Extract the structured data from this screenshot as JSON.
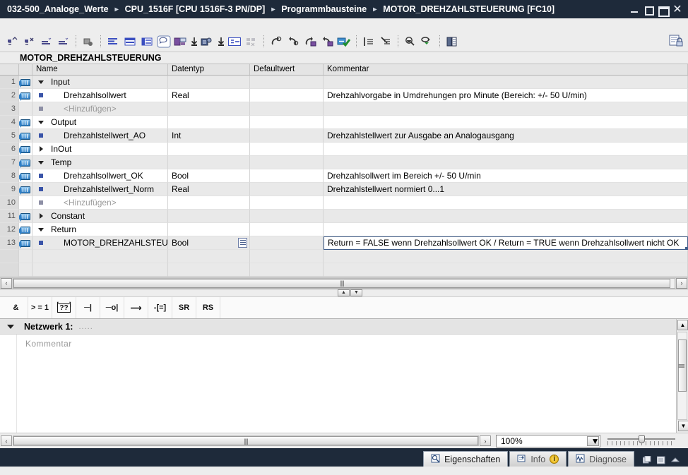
{
  "titlebar": {
    "crumbs": [
      "032-500_Analoge_Werte",
      "CPU_1516F [CPU 1516F-3 PN/DP]",
      "Programmbausteine",
      "MOTOR_DREHZAHLSTEUERUNG [FC10]"
    ],
    "separator": "▸",
    "buttons": {
      "minimize": "minimize",
      "restore": "restore",
      "maximize": "maximize",
      "close": "✕"
    }
  },
  "toolbar": {
    "icons": [
      "insert-network-icon",
      "cut-network-icon",
      "insert-branch-icon",
      "delete-branch-icon",
      "sep",
      "absolute-symbolic-icon",
      "sep",
      "show-absolute-operands-icon",
      "show-symbolic-operands-icon",
      "show-operand-info-icon",
      "comments-icon",
      "insert-network-title-icon",
      "download-to-device-icon",
      "upload-from-device-icon",
      "favorites-icon",
      "disable-layout-icon"
    ],
    "icons2": [
      "monitor-on-icon",
      "monitor-off-icon",
      "modify-value-icon",
      "reset-value-icon",
      "go-online-icon",
      "sep",
      "expand-all-icon",
      "collapse-all-icon",
      "sep",
      "cross-reference-icon",
      "call-structure-icon",
      "sep",
      "compare-blocks-icon"
    ],
    "right_icon": "block-protection-icon"
  },
  "interface": {
    "block_name": "MOTOR_DREHZAHLSTEUERUNG",
    "columns": [
      "",
      "",
      "Name",
      "Datentyp",
      "Defaultwert",
      "Kommentar"
    ],
    "rows": [
      {
        "num": "1",
        "tag": true,
        "marker": "tri-down",
        "indent": 0,
        "name": "Input",
        "type": "",
        "def": "",
        "comment": ""
      },
      {
        "num": "2",
        "tag": true,
        "marker": "sq-blue",
        "indent": 1,
        "name": "Drehzahlsollwert",
        "type": "Real",
        "def": "",
        "comment": "Drehzahlvorgabe in Umdrehungen pro Minute (Bereich: +/- 50 U/min)"
      },
      {
        "num": "3",
        "tag": false,
        "marker": "sq-gray",
        "indent": 1,
        "name": "<Hinzufügen>",
        "type": "",
        "def": "",
        "comment": "",
        "dim": true
      },
      {
        "num": "4",
        "tag": true,
        "marker": "tri-down",
        "indent": 0,
        "name": "Output",
        "type": "",
        "def": "",
        "comment": ""
      },
      {
        "num": "5",
        "tag": true,
        "marker": "sq-blue",
        "indent": 1,
        "name": "Drehzahlstellwert_AO",
        "type": "Int",
        "def": "",
        "comment": "Drehzahlstellwert zur Ausgabe an Analogausgang"
      },
      {
        "num": "6",
        "tag": true,
        "marker": "tri-right",
        "indent": 0,
        "name": "InOut",
        "type": "",
        "def": "",
        "comment": ""
      },
      {
        "num": "7",
        "tag": true,
        "marker": "tri-down",
        "indent": 0,
        "name": "Temp",
        "type": "",
        "def": "",
        "comment": ""
      },
      {
        "num": "8",
        "tag": true,
        "marker": "sq-blue",
        "indent": 1,
        "name": "Drehzahlsollwert_OK",
        "type": "Bool",
        "def": "",
        "comment": "Drehzahlsollwert im Bereich +/- 50 U/min"
      },
      {
        "num": "9",
        "tag": true,
        "marker": "sq-blue",
        "indent": 1,
        "name": "Drehzahlstellwert_Norm",
        "type": "Real",
        "def": "",
        "comment": "Drehzahlstellwert normiert 0...1"
      },
      {
        "num": "10",
        "tag": false,
        "marker": "sq-gray",
        "indent": 1,
        "name": "<Hinzufügen>",
        "type": "",
        "def": "",
        "comment": "",
        "dim": true
      },
      {
        "num": "11",
        "tag": true,
        "marker": "tri-right",
        "indent": 0,
        "name": "Constant",
        "type": "",
        "def": "",
        "comment": ""
      },
      {
        "num": "12",
        "tag": true,
        "marker": "tri-down",
        "indent": 0,
        "name": "Return",
        "type": "",
        "def": "",
        "comment": ""
      },
      {
        "num": "13",
        "tag": true,
        "marker": "sq-blue",
        "indent": 1,
        "name": "MOTOR_DREHZAHLSTEUE",
        "type": "Bool",
        "def": "",
        "comment": "Return = FALSE wenn Drehzahlsollwert OK / Return = TRUE wenn Drehzahlsollwert nicht OK",
        "selected": true,
        "has_type_picker": true
      }
    ]
  },
  "favorites": {
    "items": [
      "&",
      "> = 1",
      "??",
      "─|",
      "─o|",
      "⟶",
      "-[=]",
      "SR",
      "RS"
    ],
    "names": [
      "and-box",
      "or-box",
      "empty-box",
      "normally-open-contact",
      "normally-closed-contact",
      "coil",
      "assignment-box",
      "set-reset-flipflop",
      "reset-set-flipflop"
    ]
  },
  "network": {
    "title": "Netzwerk 1:",
    "dots": ".....",
    "comment_placeholder": "Kommentar"
  },
  "bottom": {
    "zoom_value": "100%",
    "scroll_left": "‹",
    "scroll_right": "›"
  },
  "statusbar": {
    "tabs": [
      {
        "label": "Eigenschaften",
        "icon": "properties-icon",
        "active": true,
        "badge": ""
      },
      {
        "label": "Info",
        "icon": "info-icon",
        "active": false,
        "badge": "i"
      },
      {
        "label": "Diagnose",
        "icon": "diagnostics-icon",
        "active": false,
        "badge": ""
      }
    ]
  },
  "colors": {
    "title_bg": "#1e2a3a",
    "accent": "#3f5d8a",
    "row_alt": "#e9e9e9",
    "tag_blue": "#2f7fc6"
  }
}
